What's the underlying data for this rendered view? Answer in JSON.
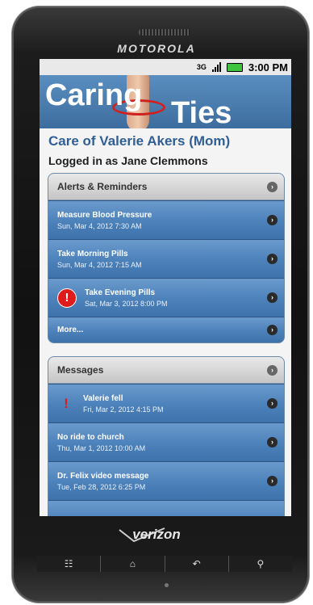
{
  "device": {
    "brand": "MOTOROLA",
    "carrier": "verizon"
  },
  "statusbar": {
    "network": "3G",
    "time": "3:00 PM"
  },
  "banner": {
    "logo_part1": "Caring",
    "logo_part2": "Ties"
  },
  "header": {
    "care_of": "Care of Valerie Akers (Mom)",
    "logged_in": "Logged in as Jane Clemmons"
  },
  "alerts": {
    "title": "Alerts & Reminders",
    "items": [
      {
        "title": "Measure Blood Pressure",
        "time": "Sun, Mar 4, 2012 7:30 AM"
      },
      {
        "title": "Take Morning Pills",
        "time": "Sun, Mar 4, 2012 7:15 AM"
      },
      {
        "title": "Take Evening Pills",
        "time": "Sat, Mar 3, 2012 8:00 PM",
        "icon": "alert-icon"
      }
    ],
    "more": "More..."
  },
  "messages": {
    "title": "Messages",
    "items": [
      {
        "title": "Valerie fell",
        "time": "Fri, Mar 2, 2012 4:15 PM",
        "icon": "exclamation-icon"
      },
      {
        "title": "No ride to church",
        "time": "Thu, Mar 1, 2012 10:00 AM"
      },
      {
        "title": "Dr. Felix video message",
        "time": "Tue, Feb 28, 2012 6:25 PM"
      }
    ]
  }
}
